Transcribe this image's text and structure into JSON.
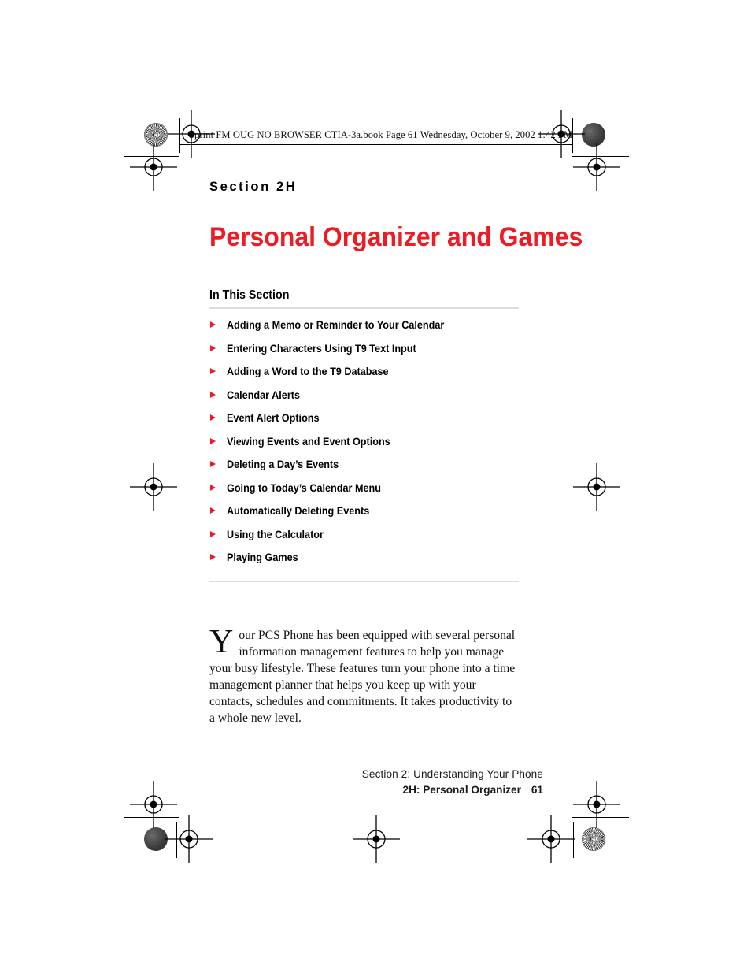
{
  "header": {
    "slug": "Sprint FM OUG NO BROWSER CTIA-3a.book  Page 61  Wednesday, October 9, 2002  1:42 PM"
  },
  "page": {
    "eyebrow": "Section 2H",
    "title": "Personal Organizer and Games",
    "accent_color": "#ed1c24",
    "in_this_section_heading": "In This Section",
    "toc_items": [
      "Adding a Memo or Reminder to Your Calendar",
      "Entering Characters Using T9 Text Input",
      "Adding a Word to the T9 Database",
      "Calendar Alerts",
      "Event Alert Options",
      "Viewing Events and Event Options",
      "Deleting a Day’s Events",
      "Going to Today’s Calendar Menu",
      "Automatically Deleting Events",
      "Using the Calculator",
      "Playing Games"
    ],
    "intro": {
      "dropcap": "Y",
      "body": "our PCS Phone has been equipped with several personal information management features to help you manage your busy lifestyle. These features turn your phone into a time management planner that helps you keep up with your contacts, schedules and commitments. It takes productivity to a whole new level."
    }
  },
  "footer": {
    "line1": "Section 2: Understanding Your Phone",
    "line2": "2H: Personal Organizer",
    "page_number": "61"
  }
}
